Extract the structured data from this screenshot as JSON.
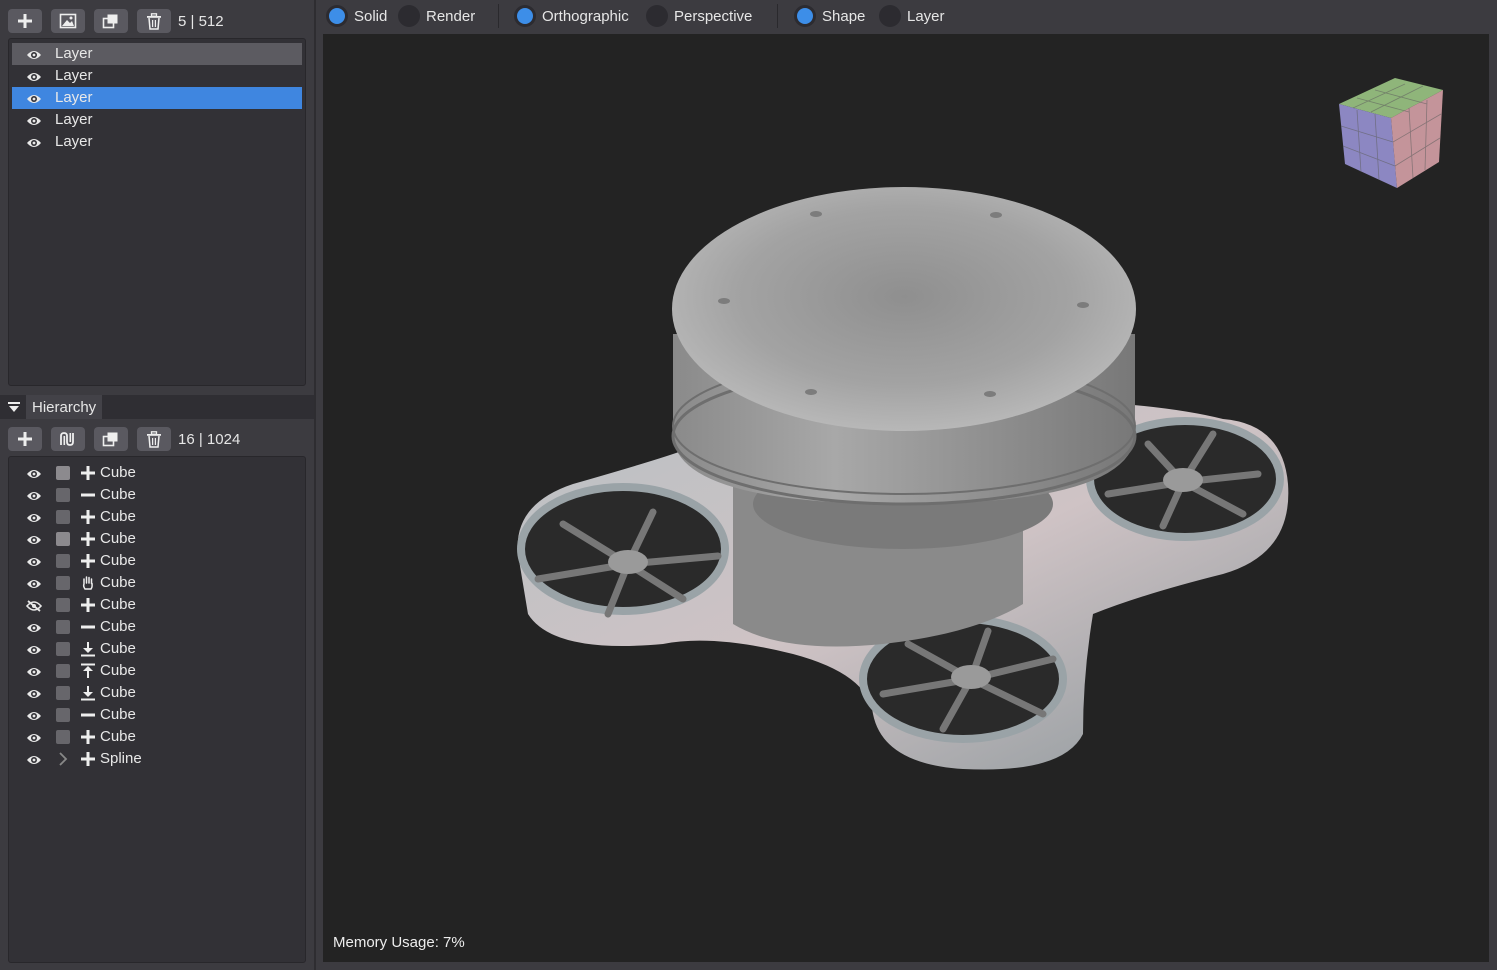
{
  "layers_toolbar": {
    "buttons": [
      "add-icon",
      "image-icon",
      "duplicate-icon",
      "trash-icon"
    ],
    "count": "5 | 512"
  },
  "layers": [
    {
      "label": "Layer",
      "state": "hover"
    },
    {
      "label": "Layer",
      "state": "normal"
    },
    {
      "label": "Layer",
      "state": "selected"
    },
    {
      "label": "Layer",
      "state": "normal"
    },
    {
      "label": "Layer",
      "state": "normal"
    }
  ],
  "hierarchy": {
    "tab_label": "Hierarchy",
    "toolbar": {
      "buttons": [
        "add-icon",
        "spline-tool-icon",
        "duplicate-icon",
        "trash-icon"
      ],
      "count": "16 | 1024"
    },
    "items": [
      {
        "label": "Cube",
        "op": "plus",
        "visible": true,
        "swatch": "light"
      },
      {
        "label": "Cube",
        "op": "minus",
        "visible": true,
        "swatch": "dark"
      },
      {
        "label": "Cube",
        "op": "plus",
        "visible": true,
        "swatch": "dark"
      },
      {
        "label": "Cube",
        "op": "plus",
        "visible": true,
        "swatch": "light"
      },
      {
        "label": "Cube",
        "op": "plus",
        "visible": true,
        "swatch": "dark"
      },
      {
        "label": "Cube",
        "op": "hand",
        "visible": true,
        "swatch": "dark"
      },
      {
        "label": "Cube",
        "op": "plus",
        "visible": false,
        "swatch": "dark"
      },
      {
        "label": "Cube",
        "op": "minus",
        "visible": true,
        "swatch": "dark"
      },
      {
        "label": "Cube",
        "op": "down",
        "visible": true,
        "swatch": "dark"
      },
      {
        "label": "Cube",
        "op": "up",
        "visible": true,
        "swatch": "dark"
      },
      {
        "label": "Cube",
        "op": "down",
        "visible": true,
        "swatch": "dark"
      },
      {
        "label": "Cube",
        "op": "minus",
        "visible": true,
        "swatch": "dark"
      },
      {
        "label": "Cube",
        "op": "plus",
        "visible": true,
        "swatch": "dark"
      },
      {
        "label": "Spline",
        "op": "plus",
        "visible": true,
        "swatch": "chevron"
      }
    ]
  },
  "viewport_toolbar": {
    "shading": [
      {
        "label": "Solid",
        "selected": true
      },
      {
        "label": "Render",
        "selected": false
      }
    ],
    "projection": [
      {
        "label": "Orthographic",
        "selected": true
      },
      {
        "label": "Perspective",
        "selected": false
      }
    ],
    "mode": [
      {
        "label": "Shape",
        "selected": true
      },
      {
        "label": "Layer",
        "selected": false
      }
    ]
  },
  "viewport": {
    "memory_usage": "Memory Usage: 7%"
  },
  "colors": {
    "accent": "#3f86e0",
    "panel": "#3c3b40",
    "viewport_bg": "#232323"
  }
}
